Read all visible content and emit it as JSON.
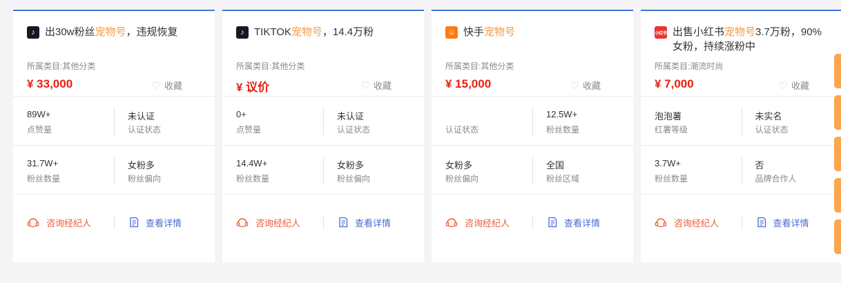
{
  "cards": [
    {
      "platform_icon": "tiktok-icon",
      "icon_glyph": "♪",
      "title_pre": "出30w粉丝",
      "title_hl": "宠物号",
      "title_post": "，违规恢复",
      "category": "所属类目:其他分类",
      "price": "¥ 33,000",
      "fav_label": "收藏",
      "stats": [
        {
          "value": "89W+",
          "label": "点赞量"
        },
        {
          "value": "未认证",
          "label": "认证状态"
        },
        {
          "value": "31.7W+",
          "label": "粉丝数量"
        },
        {
          "value": "女粉多",
          "label": "粉丝偏向"
        }
      ],
      "consult_label": "咨询经纪人",
      "detail_label": "查看详情"
    },
    {
      "platform_icon": "tiktok-icon",
      "icon_glyph": "♪",
      "title_pre": "TIKTOK",
      "title_hl": "宠物号",
      "title_post": "，14.4万粉",
      "category": "所属类目:其他分类",
      "price": "¥ 议价",
      "fav_label": "收藏",
      "stats": [
        {
          "value": "0+",
          "label": "点赞量"
        },
        {
          "value": "未认证",
          "label": "认证状态"
        },
        {
          "value": "14.4W+",
          "label": "粉丝数量"
        },
        {
          "value": "女粉多",
          "label": "粉丝偏向"
        }
      ],
      "consult_label": "咨询经纪人",
      "detail_label": "查看详情"
    },
    {
      "platform_icon": "kuaishou-icon",
      "icon_glyph": "☺",
      "title_pre": "快手",
      "title_hl": "宠物号",
      "title_post": "",
      "category": "所属类目:其他分类",
      "price": "¥ 15,000",
      "fav_label": "收藏",
      "stats": [
        {
          "value": "",
          "label": "认证状态"
        },
        {
          "value": "12.5W+",
          "label": "粉丝数量"
        },
        {
          "value": "女粉多",
          "label": "粉丝偏向"
        },
        {
          "value": "全国",
          "label": "粉丝区域"
        }
      ],
      "consult_label": "咨询经纪人",
      "detail_label": "查看详情"
    },
    {
      "platform_icon": "xiaohongshu-icon",
      "icon_glyph": "小红书",
      "title_pre": "出售小红书",
      "title_hl": "宠物号",
      "title_post": "3.7万粉，90%女粉，持续涨粉中",
      "category": "所属类目:潮流时尚",
      "price": "¥ 7,000",
      "fav_label": "收藏",
      "stats": [
        {
          "value": "泡泡薯",
          "label": "红薯等级"
        },
        {
          "value": "未实名",
          "label": "认证状态"
        },
        {
          "value": "3.7W+",
          "label": "粉丝数量"
        },
        {
          "value": "否",
          "label": "品牌合作人"
        }
      ],
      "consult_label": "咨询经纪人",
      "detail_label": "查看详情"
    }
  ],
  "colors": {
    "accent_border": "#3d76d6",
    "highlight": "#f39a44",
    "price": "#e8200f",
    "consult": "#ee5b36",
    "detail": "#4a6ad2",
    "side_tab": "#f9a64c"
  }
}
